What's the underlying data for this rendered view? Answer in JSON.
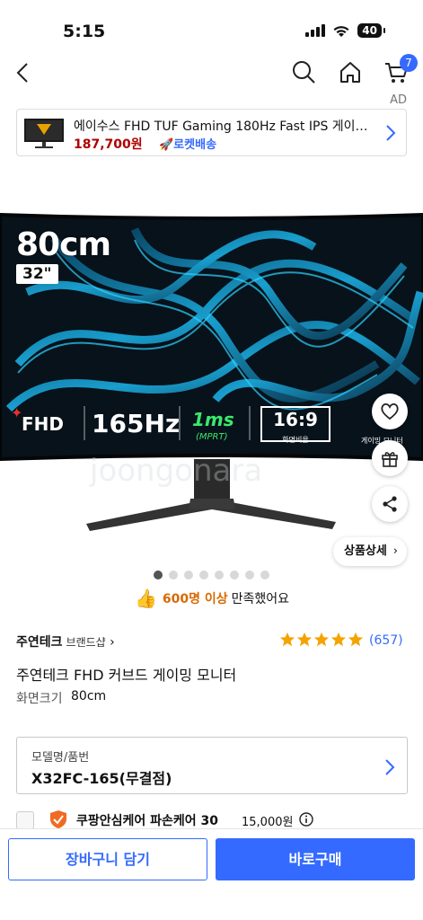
{
  "status": {
    "time": "5:15",
    "battery": "40"
  },
  "nav": {
    "cart_count": "7"
  },
  "ad": {
    "tag": "AD",
    "title": "에이수스 FHD TUF Gaming 180Hz Fast IPS 게이밍 모니터",
    "price": "187,700원",
    "delivery": "🚀로켓배송"
  },
  "hero": {
    "size": "80cm",
    "inch": "32\"",
    "spec_fhd": "FHD",
    "spec_hz": "165Hz",
    "spec_ms": "1ms",
    "spec_mprt": "(MPRT)",
    "spec_ratio": "16:9",
    "spec_ratio_sub": "화면비율",
    "spec_game": "게이밍 모니터",
    "watermark": "joongonara",
    "detail_button": "상품상세"
  },
  "carousel": {
    "total": 8,
    "active": 0
  },
  "satisfaction": {
    "emoji": "👍",
    "highlight": "600명 이상",
    "suffix": "만족했어요"
  },
  "product": {
    "brand": "주연테크",
    "brand_shop": "브랜드샵",
    "rating": 5,
    "review_count": "(657)",
    "title": "주연테크 FHD 커브드 게이밍 모니터",
    "attr_label": "화면크기",
    "attr_value": "80cm"
  },
  "option": {
    "label": "모델명/품번",
    "value": "X32FC-165(무결점)"
  },
  "care": {
    "label": "쿠팡안심케어 파손케어 30",
    "price": "15,000원"
  },
  "bottom": {
    "cart_button": "장바구니 담기",
    "buy_button": "바로구매"
  },
  "colors": {
    "accent": "#346aff",
    "price_red": "#ae0000",
    "star": "#f5a300",
    "highlight": "#d96900"
  }
}
